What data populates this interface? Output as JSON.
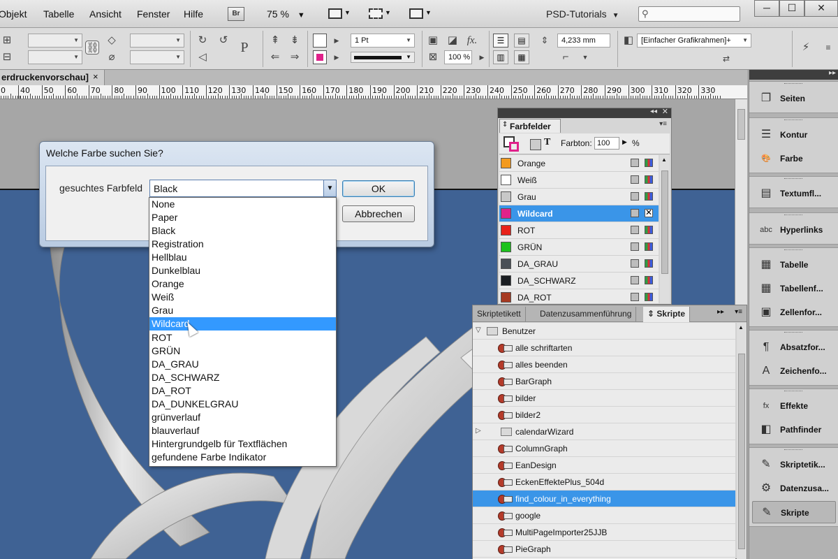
{
  "menubar": {
    "items": [
      "Objekt",
      "Tabelle",
      "Ansicht",
      "Fenster",
      "Hilfe"
    ],
    "bridge_badge": "Br",
    "zoom": "75 %",
    "workspace": "PSD-Tutorials",
    "window_buttons": [
      "─",
      "☐",
      "✕"
    ]
  },
  "toolbar": {
    "stroke_weight": "1 Pt",
    "offset_value": "4,233 mm",
    "frame_style": "[Einfacher Grafikrahmen]+",
    "opacity": "100 %",
    "paragraph_glyph": "P",
    "fx_label": "fx."
  },
  "document": {
    "tab_title": "erdruckenvorschau]",
    "close": "×",
    "ruler_labels": [
      "0",
      "40",
      "50",
      "60",
      "70",
      "80",
      "90",
      "100",
      "110",
      "120",
      "130",
      "140",
      "150",
      "160",
      "170",
      "180",
      "190",
      "200",
      "210",
      "220",
      "230",
      "240",
      "250",
      "260",
      "270",
      "280",
      "290",
      "300",
      "310",
      "320",
      "330"
    ]
  },
  "dialog": {
    "title": "Welche Farbe suchen Sie?",
    "field_label": "gesuchtes Farbfeld",
    "selected_value": "Black",
    "ok_label": "OK",
    "cancel_label": "Abbrechen",
    "highlighted_index": 9,
    "options": [
      "None",
      "Paper",
      "Black",
      "Registration",
      "Hellblau",
      "Dunkelblau",
      "Orange",
      "Weiß",
      "Grau",
      "Wildcard",
      "ROT",
      "GRÜN",
      "DA_GRAU",
      "DA_SCHWARZ",
      "DA_ROT",
      "DA_DUNKELGRAU",
      "grünverlauf",
      "blauverlauf",
      "Hintergrundgelb für Textflächen",
      "gefundene Farbe Indikator"
    ]
  },
  "swatches_panel": {
    "title": "Farbfelder",
    "tint_label": "Farbton:",
    "tint_value": "100",
    "tint_unit": "%",
    "text_glyph": "T",
    "selected_index": 3,
    "items": [
      {
        "name": "Orange",
        "color": "#f39a1f"
      },
      {
        "name": "Weiß",
        "color": "#ffffff"
      },
      {
        "name": "Grau",
        "color": "#c8c8c8"
      },
      {
        "name": "Wildcard",
        "color": "#e0218a"
      },
      {
        "name": "ROT",
        "color": "#e8221a"
      },
      {
        "name": "GRÜN",
        "color": "#1dc21d"
      },
      {
        "name": "DA_GRAU",
        "color": "#4a5057"
      },
      {
        "name": "DA_SCHWARZ",
        "color": "#1a1d22"
      },
      {
        "name": "DA_ROT",
        "color": "#a63a22"
      }
    ]
  },
  "scripts_panel": {
    "tabs": [
      "Skriptetikett",
      "Datenzusammenführung",
      "Skripte"
    ],
    "active_tab": 2,
    "root_folder": "Benutzer",
    "selected_index": 9,
    "items": [
      {
        "name": "alle schriftarten",
        "type": "script"
      },
      {
        "name": "alles beenden",
        "type": "script"
      },
      {
        "name": "BarGraph",
        "type": "script"
      },
      {
        "name": "bilder",
        "type": "script"
      },
      {
        "name": "bilder2",
        "type": "script"
      },
      {
        "name": "calendarWizard",
        "type": "folder"
      },
      {
        "name": "ColumnGraph",
        "type": "script"
      },
      {
        "name": "EanDesign",
        "type": "script"
      },
      {
        "name": "EckenEffektePlus_504d",
        "type": "script"
      },
      {
        "name": "find_colour_in_everything",
        "type": "script"
      },
      {
        "name": "google",
        "type": "script"
      },
      {
        "name": "MultiPageImporter25JJB",
        "type": "script"
      },
      {
        "name": "PieGraph",
        "type": "script"
      }
    ]
  },
  "right_dock": {
    "groups": [
      {
        "items": [
          {
            "label": "Seiten",
            "icon": "pages-icon",
            "glyph": "❐"
          }
        ]
      },
      {
        "items": [
          {
            "label": "Kontur",
            "icon": "stroke-icon",
            "glyph": "☰"
          },
          {
            "label": "Farbe",
            "icon": "color-icon",
            "glyph": "🎨"
          }
        ]
      },
      {
        "items": [
          {
            "label": "Textumfl...",
            "icon": "text-wrap-icon",
            "glyph": "▤"
          }
        ]
      },
      {
        "items": [
          {
            "label": "Hyperlinks",
            "icon": "hyperlinks-icon",
            "glyph": "abc"
          }
        ]
      },
      {
        "items": [
          {
            "label": "Tabelle",
            "icon": "table-icon",
            "glyph": "▦"
          },
          {
            "label": "Tabellenf...",
            "icon": "table-styles-icon",
            "glyph": "▦"
          },
          {
            "label": "Zellenfor...",
            "icon": "cell-styles-icon",
            "glyph": "▣"
          }
        ]
      },
      {
        "items": [
          {
            "label": "Absatzfor...",
            "icon": "paragraph-styles-icon",
            "glyph": "¶"
          },
          {
            "label": "Zeichenfo...",
            "icon": "character-styles-icon",
            "glyph": "A"
          }
        ]
      },
      {
        "items": [
          {
            "label": "Effekte",
            "icon": "effects-icon",
            "glyph": "fx"
          },
          {
            "label": "Pathfinder",
            "icon": "pathfinder-icon",
            "glyph": "◧"
          }
        ]
      },
      {
        "items": [
          {
            "label": "Skriptetik...",
            "icon": "script-label-icon",
            "glyph": "✎"
          },
          {
            "label": "Datenzusa...",
            "icon": "data-merge-icon",
            "glyph": "⚙"
          },
          {
            "label": "Skripte",
            "icon": "scripts-icon",
            "glyph": "✎",
            "active": true
          }
        ]
      }
    ]
  }
}
